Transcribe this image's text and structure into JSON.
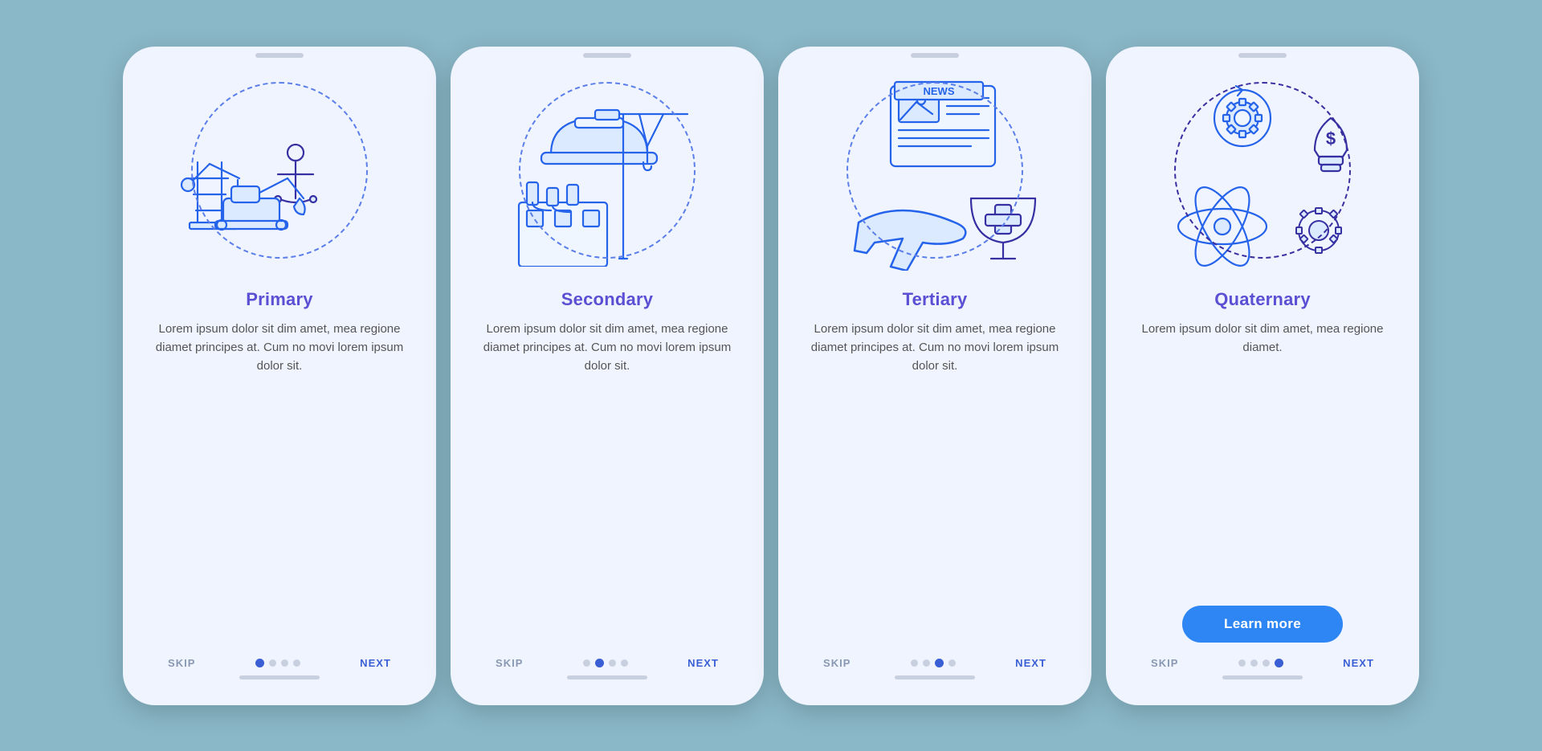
{
  "background": "#8ab8c8",
  "cards": [
    {
      "id": "primary",
      "title": "Primary",
      "body": "Lorem ipsum dolor sit dim amet, mea regione diamet principes at. Cum no movi lorem ipsum dolor sit.",
      "dots": [
        true,
        false,
        false,
        false
      ],
      "active_dot": 0,
      "has_learn_more": false,
      "skip_label": "SKIP",
      "next_label": "NEXT"
    },
    {
      "id": "secondary",
      "title": "Secondary",
      "body": "Lorem ipsum dolor sit dim amet, mea regione diamet principes at. Cum no movi lorem ipsum dolor sit.",
      "dots": [
        false,
        true,
        false,
        false
      ],
      "active_dot": 1,
      "has_learn_more": false,
      "skip_label": "SKIP",
      "next_label": "NEXT"
    },
    {
      "id": "tertiary",
      "title": "Tertiary",
      "body": "Lorem ipsum dolor sit dim amet, mea regione diamet principes at. Cum no movi lorem ipsum dolor sit.",
      "dots": [
        false,
        false,
        true,
        false
      ],
      "active_dot": 2,
      "has_learn_more": false,
      "skip_label": "SKIP",
      "next_label": "NEXT"
    },
    {
      "id": "quaternary",
      "title": "Quaternary",
      "body": "Lorem ipsum dolor sit dim amet, mea regione diamet.",
      "dots": [
        false,
        false,
        false,
        true
      ],
      "active_dot": 3,
      "has_learn_more": true,
      "learn_more_label": "Learn more",
      "skip_label": "SKIP",
      "next_label": "NEXT"
    }
  ]
}
